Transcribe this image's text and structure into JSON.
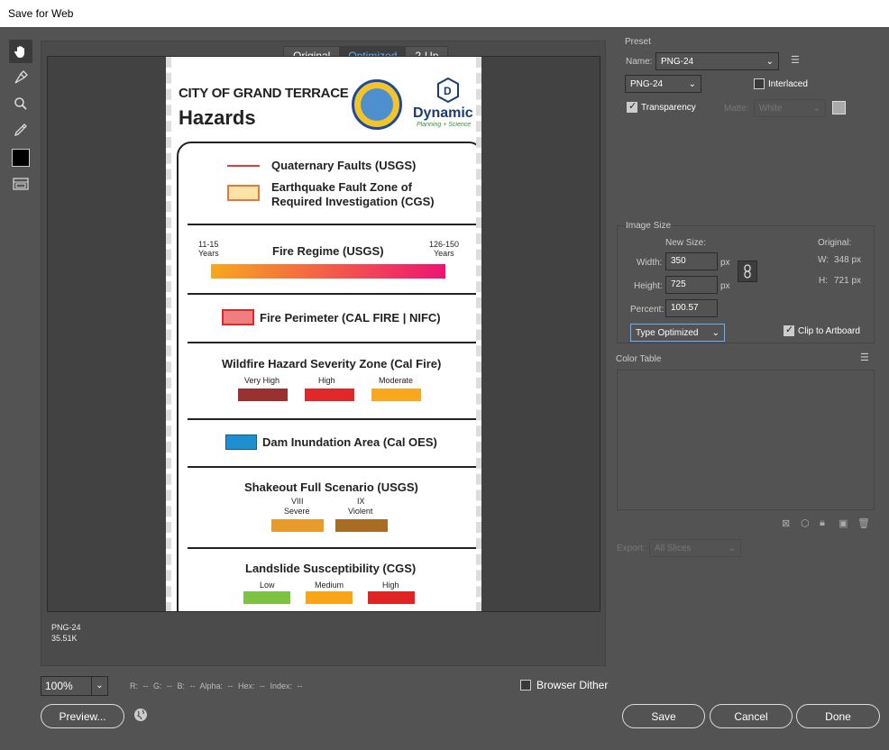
{
  "window": {
    "title": "Save for Web"
  },
  "tabs": [
    {
      "label": "Original"
    },
    {
      "label": "Optimized"
    },
    {
      "label": "2-Up"
    }
  ],
  "artboard": {
    "header_line1": "CITY OF GRAND TERRACE",
    "header_line2": "Hazards",
    "logo_name": "Dynamic",
    "logo_sub": "Planning + Science",
    "legend": {
      "faults": "Quaternary Faults (USGS)",
      "fault_zone_l1": "Earthquake Fault Zone of",
      "fault_zone_l2": "Required Investigation (CGS)",
      "fire_regime": "Fire Regime (USGS)",
      "fire_min_l1": "11-15",
      "fire_min_l2": "Years",
      "fire_max_l1": "126-150",
      "fire_max_l2": "Years",
      "fire_perimeter": "Fire Perimeter (CAL FIRE | NIFC)",
      "whsz": "Wildfire Hazard Severity Zone (Cal Fire)",
      "whsz_items": [
        "Very High",
        "High",
        "Moderate"
      ],
      "dam": "Dam Inundation Area (Cal OES)",
      "shakeout": "Shakeout Full Scenario (USGS)",
      "shake_items": [
        {
          "l1": "VIII",
          "l2": "Severe"
        },
        {
          "l1": "IX",
          "l2": "Violent"
        }
      ],
      "landslide": "Landslide Susceptibility (CGS)",
      "landslide_items": [
        "Low",
        "Medium",
        "High"
      ]
    },
    "colors": {
      "fault_line": "#e23b3b",
      "fault_zone": "#fde3a8",
      "fire_perimeter": "#f08080",
      "very_high": "#9b3030",
      "high": "#e02828",
      "moderate": "#f7a81f",
      "dam": "#1f8fd0",
      "viii": "#e89a2c",
      "ix": "#a86d24",
      "low": "#7dc242",
      "medium": "#f9a51a",
      "ls_high": "#e02323"
    }
  },
  "status": {
    "format": "PNG-24",
    "size": "35.51K"
  },
  "zoom": {
    "value": "100%"
  },
  "readout": "R: --  G: --  B: --  Alpha: --  Hex: --  Index: --",
  "browser_dither": "Browser Dither",
  "buttons": {
    "preview": "Preview...",
    "save": "Save",
    "cancel": "Cancel",
    "done": "Done"
  },
  "preset": {
    "section": "Preset",
    "name_label": "Name:",
    "name_value": "PNG-24",
    "format_value": "PNG-24",
    "interlaced": "Interlaced",
    "transparency": "Transparency",
    "matte_label": "Matte:",
    "matte_value": "White"
  },
  "image_size": {
    "section": "Image Size",
    "new_size": "New Size:",
    "original": "Original:",
    "width_label": "Width:",
    "width_value": "350",
    "height_label": "Height:",
    "height_value": "725",
    "px": "px",
    "percent_label": "Percent:",
    "percent_value": "100.57",
    "orig_w_label": "W:",
    "orig_w": "348 px",
    "orig_h_label": "H:",
    "orig_h": "721 px",
    "quality_value": "Type Optimized",
    "clip": "Clip to Artboard"
  },
  "color_table": {
    "section": "Color Table"
  },
  "export": {
    "label": "Export:",
    "value": "All Slices"
  }
}
